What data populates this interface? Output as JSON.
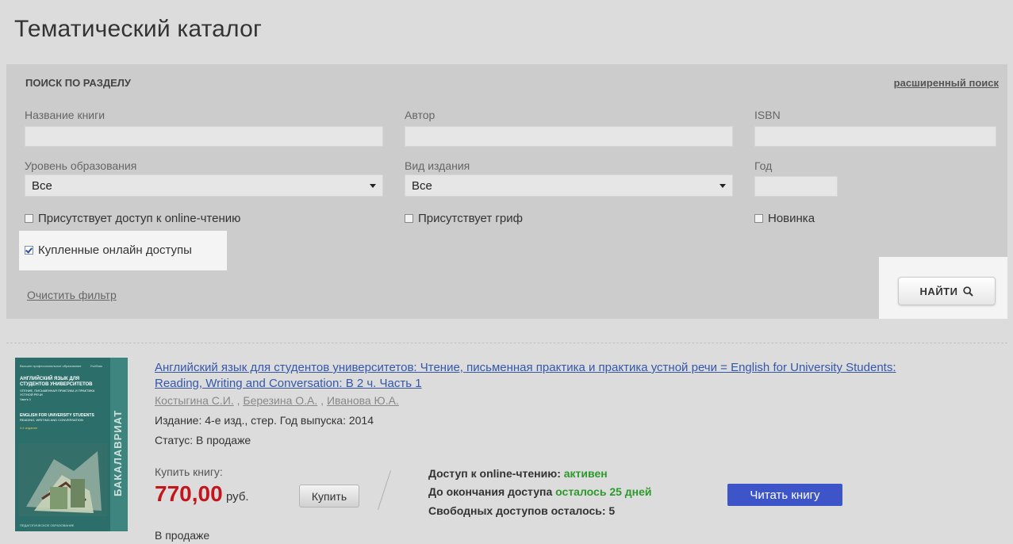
{
  "page": {
    "title": "Тематический каталог"
  },
  "search": {
    "section_label": "ПОИСК ПО РАЗДЕЛУ",
    "advanced_link": "расширенный поиск",
    "book_title_label": "Название книги",
    "book_title_value": "",
    "author_label": "Автор",
    "author_value": "",
    "isbn_label": "ISBN",
    "isbn_value": "",
    "education_level_label": "Уровень образования",
    "education_level_value": "Все",
    "edition_type_label": "Вид издания",
    "edition_type_value": "Все",
    "year_label": "Год",
    "year_value": "",
    "checkbox_online": {
      "label": "Присутствует доступ к online-чтению",
      "checked": false
    },
    "checkbox_grif": {
      "label": "Присутствует гриф",
      "checked": false
    },
    "checkbox_new": {
      "label": "Новинка",
      "checked": false
    },
    "checkbox_purchased": {
      "label": "Купленные онлайн доступы",
      "checked": true
    },
    "clear_filter": "Очистить фильтр",
    "find_button": "НАЙТИ"
  },
  "book": {
    "title": "Английский язык для студентов университетов: Чтение, письменная практика и практика устной речи = English for University Students: Reading, Writing and Conversation: В 2 ч. Часть 1",
    "authors": [
      "Костыгина С.И.",
      "Березина О.А.",
      "Иванова Ю.А."
    ],
    "edition": "Издание: 4-е изд., стер. Год выпуска: 2014",
    "status": "Статус: В продаже",
    "buy_label": "Купить книгу:",
    "price": "770,00",
    "currency": "руб.",
    "buy_button": "Купить",
    "access_label": "Доступ к online-чтению: ",
    "access_value": "активен",
    "expiry_label": "До окончания доступа ",
    "expiry_value": "осталось 25 дней",
    "free_access": "Свободных доступов осталось: 5",
    "read_button": "Читать книгу",
    "on_sale": "В продаже",
    "cover": {
      "series_top": "Высшее профессиональное образование",
      "badge": "Учебник",
      "title_ru": "АНГЛИЙСКИЙ ЯЗЫК ДЛЯ СТУДЕНТОВ УНИВЕРСИТЕТОВ",
      "subtitle_ru": "ЧТЕНИЕ, ПИСЬМЕННАЯ ПРАКТИКА И ПРАКТИКА УСТНОЙ РЕЧИ",
      "part": "Часть 1",
      "title_en": "ENGLISH FOR UNIVERSITY STUDENTS",
      "subtitle_en": "READING, WRITING AND CONVERSATION",
      "edition": "4-е издание",
      "spine": "БАКАЛАВРИАТ",
      "publisher": "ПЕДАГОГИЧЕСКОЕ ОБРАЗОВАНИЕ"
    }
  },
  "colors": {
    "price": "#c3161c",
    "active": "#2c9a2c",
    "read_button": "#3d55c8",
    "link": "#3557a8"
  }
}
